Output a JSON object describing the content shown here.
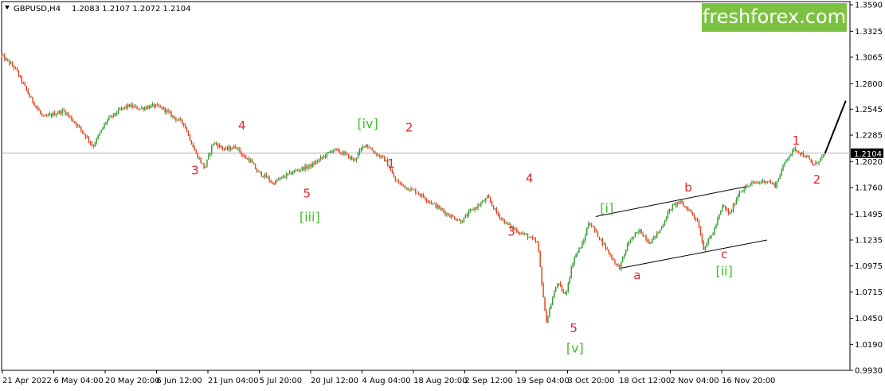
{
  "header": {
    "symbol": "GBPUSD,H4",
    "ohlc": "1.2083 1.2107 1.2072 1.2104"
  },
  "brand": {
    "text": "freshforex.com",
    "color": "#7cc242"
  },
  "colors": {
    "bull": "#2e9b2e",
    "bear": "#e2401b",
    "wave_red": "#e2272b",
    "wave_green": "#3fbf2b",
    "channel": "#000000"
  },
  "chart_data": {
    "type": "candlestick",
    "title": "",
    "xlabel": "",
    "ylabel": "",
    "ylim": [
      0.993,
      1.359
    ],
    "grid": false,
    "current_price": "1.2104",
    "y_ticks": [
      "1.3590",
      "1.3325",
      "1.3065",
      "1.2800",
      "1.2545",
      "1.2285",
      "1.2020",
      "1.1760",
      "1.1495",
      "1.1235",
      "1.0975",
      "1.0715",
      "1.0450",
      "1.0190",
      "0.9930"
    ],
    "x_ticks": [
      "21 Apr 2022",
      "6 May 04:00",
      "20 May 20:00",
      "6 Jun 12:00",
      "21 Jun 04:00",
      "5 Jul 20:00",
      "20 Jul 12:00",
      "4 Aug 04:00",
      "18 Aug 20:00",
      "2 Sep 12:00",
      "19 Sep 04:00",
      "3 Oct 20:00",
      "18 Oct 12:00",
      "2 Nov 04:00",
      "16 Nov 20:00"
    ],
    "path_anchors": [
      {
        "t": 0.0,
        "p": 1.308
      },
      {
        "t": 1.0,
        "p": 1.295
      },
      {
        "t": 2.0,
        "p": 1.268
      },
      {
        "t": 3.0,
        "p": 1.246
      },
      {
        "t": 4.5,
        "p": 1.253
      },
      {
        "t": 5.5,
        "p": 1.238
      },
      {
        "t": 6.3,
        "p": 1.224
      },
      {
        "t": 6.6,
        "p": 1.217
      },
      {
        "t": 7.6,
        "p": 1.243
      },
      {
        "t": 8.6,
        "p": 1.254
      },
      {
        "t": 9.2,
        "p": 1.258
      },
      {
        "t": 10.0,
        "p": 1.255
      },
      {
        "t": 11.0,
        "p": 1.258
      },
      {
        "t": 11.7,
        "p": 1.255
      },
      {
        "t": 12.4,
        "p": 1.247
      },
      {
        "t": 13.2,
        "p": 1.24
      },
      {
        "t": 14.0,
        "p": 1.212
      },
      {
        "t": 14.7,
        "p": 1.195
      },
      {
        "t": 15.3,
        "p": 1.221
      },
      {
        "t": 16.2,
        "p": 1.214
      },
      {
        "t": 17.0,
        "p": 1.217
      },
      {
        "t": 17.5,
        "p": 1.207
      },
      {
        "t": 18.0,
        "p": 1.203
      },
      {
        "t": 18.5,
        "p": 1.192
      },
      {
        "t": 19.3,
        "p": 1.185
      },
      {
        "t": 19.6,
        "p": 1.18
      },
      {
        "t": 20.3,
        "p": 1.186
      },
      {
        "t": 21.3,
        "p": 1.193
      },
      {
        "t": 22.4,
        "p": 1.198
      },
      {
        "t": 23.2,
        "p": 1.206
      },
      {
        "t": 24.0,
        "p": 1.214
      },
      {
        "t": 24.8,
        "p": 1.21
      },
      {
        "t": 25.5,
        "p": 1.203
      },
      {
        "t": 26.3,
        "p": 1.22
      },
      {
        "t": 27.0,
        "p": 1.211
      },
      {
        "t": 27.8,
        "p": 1.203
      },
      {
        "t": 28.5,
        "p": 1.183
      },
      {
        "t": 29.3,
        "p": 1.176
      },
      {
        "t": 30.0,
        "p": 1.172
      },
      {
        "t": 31.2,
        "p": 1.16
      },
      {
        "t": 32.3,
        "p": 1.149
      },
      {
        "t": 33.3,
        "p": 1.142
      },
      {
        "t": 33.9,
        "p": 1.152
      },
      {
        "t": 34.5,
        "p": 1.158
      },
      {
        "t": 35.2,
        "p": 1.166
      },
      {
        "t": 35.8,
        "p": 1.151
      },
      {
        "t": 36.5,
        "p": 1.14
      },
      {
        "t": 37.5,
        "p": 1.131
      },
      {
        "t": 38.0,
        "p": 1.128
      },
      {
        "t": 38.8,
        "p": 1.12
      },
      {
        "t": 39.4,
        "p": 1.041
      },
      {
        "t": 40.2,
        "p": 1.081
      },
      {
        "t": 40.8,
        "p": 1.068
      },
      {
        "t": 41.4,
        "p": 1.105
      },
      {
        "t": 42.1,
        "p": 1.121
      },
      {
        "t": 42.5,
        "p": 1.142
      },
      {
        "t": 43.4,
        "p": 1.123
      },
      {
        "t": 44.2,
        "p": 1.105
      },
      {
        "t": 44.7,
        "p": 1.095
      },
      {
        "t": 45.4,
        "p": 1.122
      },
      {
        "t": 46.2,
        "p": 1.133
      },
      {
        "t": 46.9,
        "p": 1.121
      },
      {
        "t": 47.6,
        "p": 1.132
      },
      {
        "t": 48.4,
        "p": 1.155
      },
      {
        "t": 49.0,
        "p": 1.162
      },
      {
        "t": 49.8,
        "p": 1.153
      },
      {
        "t": 50.4,
        "p": 1.142
      },
      {
        "t": 50.8,
        "p": 1.115
      },
      {
        "t": 51.5,
        "p": 1.131
      },
      {
        "t": 52.2,
        "p": 1.158
      },
      {
        "t": 52.7,
        "p": 1.149
      },
      {
        "t": 53.4,
        "p": 1.172
      },
      {
        "t": 54.3,
        "p": 1.18
      },
      {
        "t": 55.4,
        "p": 1.183
      },
      {
        "t": 56.0,
        "p": 1.178
      },
      {
        "t": 56.8,
        "p": 1.205
      },
      {
        "t": 57.4,
        "p": 1.215
      },
      {
        "t": 58.3,
        "p": 1.206
      },
      {
        "t": 58.8,
        "p": 1.198
      },
      {
        "t": 59.6,
        "p": 1.21
      }
    ],
    "projection": [
      {
        "t": 59.6,
        "p": 1.2104
      },
      {
        "t": 61.1,
        "p": 1.263
      }
    ],
    "channel": {
      "upper": [
        {
          "t": 43.0,
          "p": 1.147
        },
        {
          "t": 53.9,
          "p": 1.177
        }
      ],
      "lower": [
        {
          "t": 44.9,
          "p": 1.0955
        },
        {
          "t": 55.4,
          "p": 1.1235
        }
      ]
    },
    "annotations": [
      {
        "text": "3",
        "t": 14.0,
        "p": 1.189,
        "color": "red"
      },
      {
        "text": "4",
        "t": 17.4,
        "p": 1.234,
        "color": "red"
      },
      {
        "text": "5",
        "t": 22.1,
        "p": 1.166,
        "color": "red"
      },
      {
        "text": "[iii]",
        "t": 22.3,
        "p": 1.142,
        "color": "green"
      },
      {
        "text": "[iv]",
        "t": 26.5,
        "p": 1.2355,
        "color": "green"
      },
      {
        "text": "2",
        "t": 29.5,
        "p": 1.232,
        "color": "red"
      },
      {
        "text": "1",
        "t": 28.2,
        "p": 1.196,
        "color": "red"
      },
      {
        "text": "4",
        "t": 38.2,
        "p": 1.181,
        "color": "red"
      },
      {
        "text": "3",
        "t": 36.9,
        "p": 1.128,
        "color": "red"
      },
      {
        "text": "5",
        "t": 41.4,
        "p": 1.031,
        "color": "red"
      },
      {
        "text": "[v]",
        "t": 41.5,
        "p": 1.011,
        "color": "green"
      },
      {
        "text": "[i]",
        "t": 43.8,
        "p": 1.151,
        "color": "green"
      },
      {
        "text": "b",
        "t": 49.7,
        "p": 1.172,
        "color": "red"
      },
      {
        "text": "a",
        "t": 46.0,
        "p": 1.084,
        "color": "red"
      },
      {
        "text": "c",
        "t": 52.3,
        "p": 1.105,
        "color": "red"
      },
      {
        "text": "[ii]",
        "t": 52.3,
        "p": 1.088,
        "color": "green"
      },
      {
        "text": "1",
        "t": 57.5,
        "p": 1.219,
        "color": "red"
      },
      {
        "text": "2",
        "t": 59.0,
        "p": 1.18,
        "color": "red"
      }
    ]
  }
}
